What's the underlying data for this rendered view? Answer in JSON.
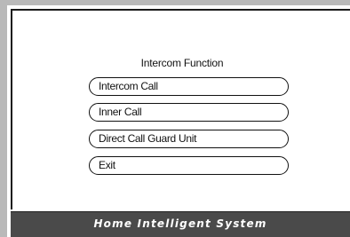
{
  "screen": {
    "title": "Intercom Function",
    "menu": [
      {
        "label": "Intercom Call"
      },
      {
        "label": "Inner Call"
      },
      {
        "label": "Direct Call Guard Unit"
      },
      {
        "label": "Exit"
      }
    ]
  },
  "footer": {
    "text": "Home Intelligent System"
  },
  "colors": {
    "frame": "#b9b9b9",
    "footer_bg": "#4a4a4a",
    "footer_text": "#ffffff",
    "outline": "#111111"
  }
}
